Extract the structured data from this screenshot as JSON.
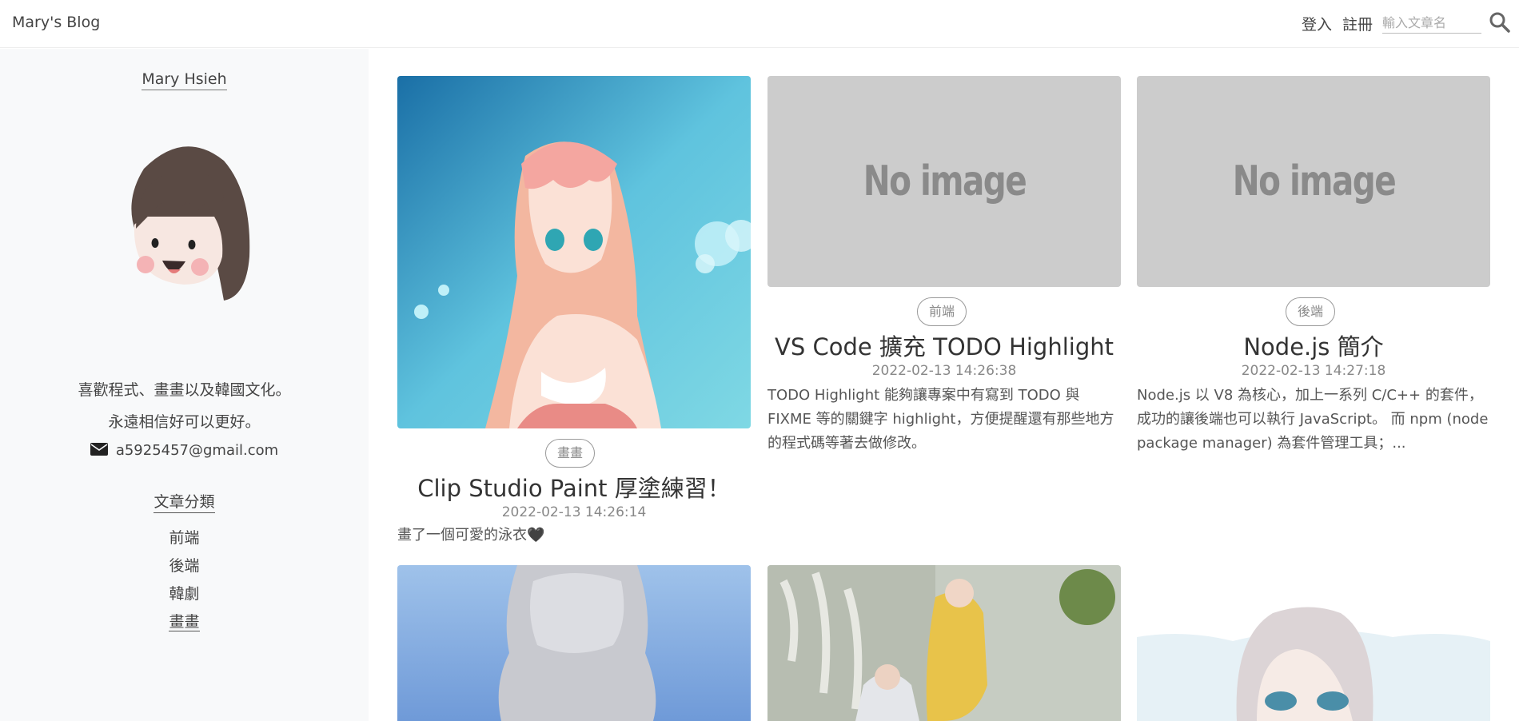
{
  "header": {
    "brand": "Mary's Blog",
    "login": "登入",
    "register": "註冊",
    "search_placeholder": "輸入文章名"
  },
  "sidebar": {
    "author": "Mary Hsieh",
    "bio_line1": "喜歡程式、畫畫以及韓國文化。",
    "bio_line2": "永遠相信好可以更好。",
    "email": "a5925457@gmail.com",
    "categories_title": "文章分類",
    "categories": [
      "前端",
      "後端",
      "韓劇",
      "畫畫"
    ],
    "active_category": "畫畫"
  },
  "posts": [
    {
      "tag": "畫畫",
      "title": "Clip Studio Paint 厚塗練習！",
      "date": "2022-02-13 14:26:14",
      "excerpt": "畫了一個可愛的泳衣🖤",
      "image": "anime-girl-illustration"
    },
    {
      "tag": "前端",
      "title": "VS Code 擴充 TODO Highlight",
      "date": "2022-02-13 14:26:38",
      "excerpt": "TODO Highlight 能夠讓專案中有寫到 TODO 與 FIXME 等的關鍵字 highlight，方便提醒還有那些地方的程式碼等著去做修改。",
      "image_text": "No image"
    },
    {
      "tag": "後端",
      "title": "Node.js 簡介",
      "date": "2022-02-13 14:27:18",
      "excerpt": "Node.js 以 V8 為核心，加上一系列 C/C++ 的套件，成功的讓後端也可以執行 JavaScript。 而 npm (node package manager) 為套件管理工具；...",
      "image_text": "No image"
    }
  ],
  "colors": {
    "sidebar_bg": "#f8f9fa",
    "noimage_bg": "#cccccc",
    "text": "#444444"
  }
}
